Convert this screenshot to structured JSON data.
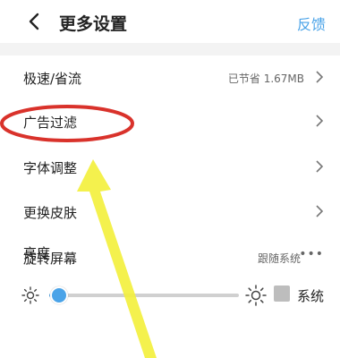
{
  "header": {
    "title": "更多设置",
    "feedback_label": "反馈",
    "accent_color": "#4aa3e8"
  },
  "settings": {
    "rows": [
      {
        "label": "极速/省流",
        "value": "已节省 1.67MB",
        "trailing": "chevron-right-icon"
      },
      {
        "label": "广告过滤",
        "value": "",
        "trailing": "chevron-right-icon"
      },
      {
        "label": "字体调整",
        "value": "",
        "trailing": "chevron-right-icon"
      },
      {
        "label": "更换皮肤",
        "value": "",
        "trailing": "chevron-right-icon"
      },
      {
        "label": "旋转屏幕",
        "value": "跟随系统",
        "trailing": "more-dots-icon"
      }
    ]
  },
  "brightness": {
    "label": "亮度",
    "level_fraction": 0.05,
    "system_label": "系统",
    "system_checked": false
  },
  "annotation": {
    "ellipse_color": "#d9322b",
    "arrow_color": "#f3ef3a"
  }
}
